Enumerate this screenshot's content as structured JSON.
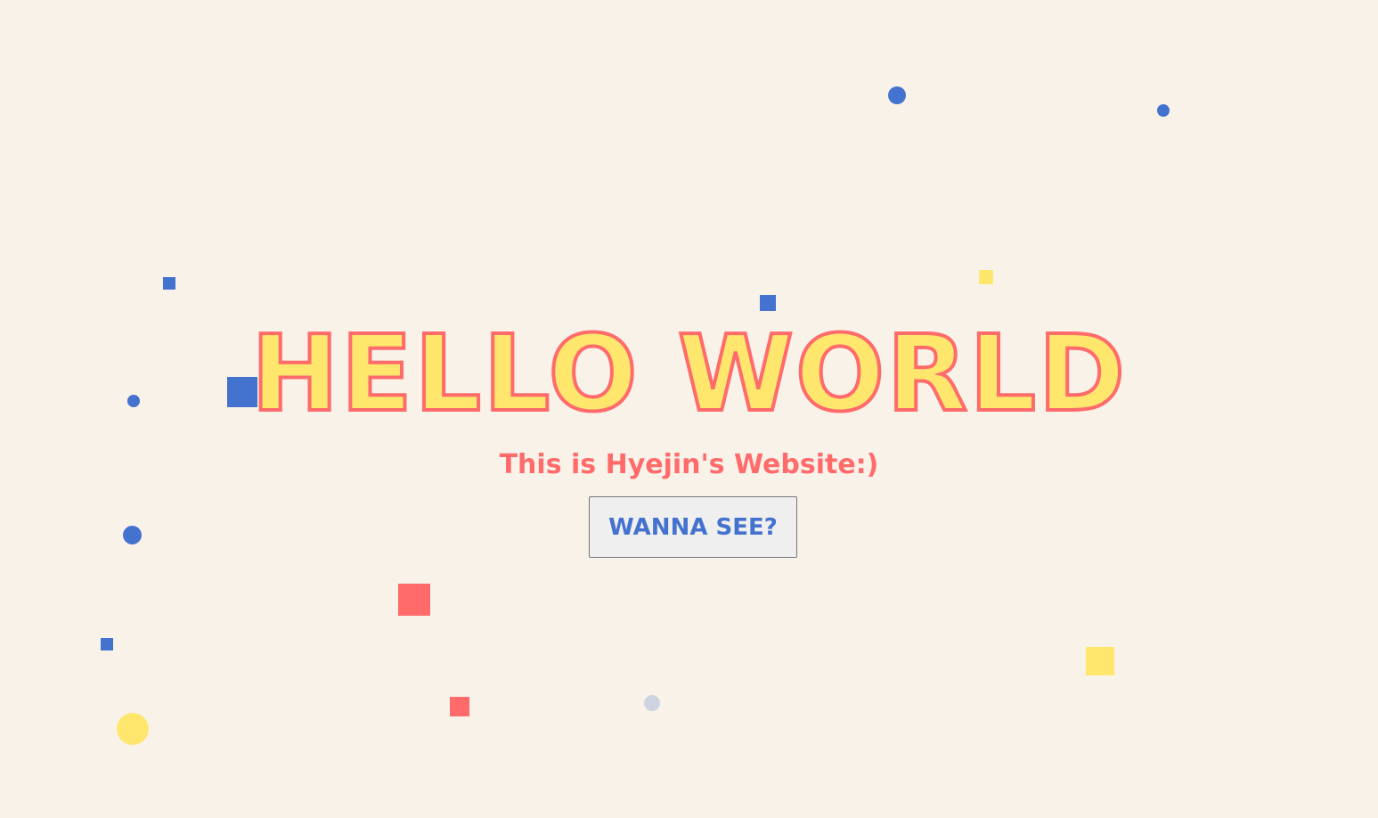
{
  "hero": {
    "title": "HELLO WORLD",
    "subtitle": "This is Hyejin's Website:)"
  },
  "cta": {
    "label": "WANNA SEE?"
  },
  "colors": {
    "background": "#f9f2e9",
    "title_fill": "#ffe66d",
    "title_outline": "#ff6b6b",
    "subtitle": "#ff6b6b",
    "accent_blue": "#4472cf",
    "confetti_yellow": "#ffe66d",
    "confetti_red": "#ff6b6b",
    "confetti_grey": "#cdd3e0"
  }
}
